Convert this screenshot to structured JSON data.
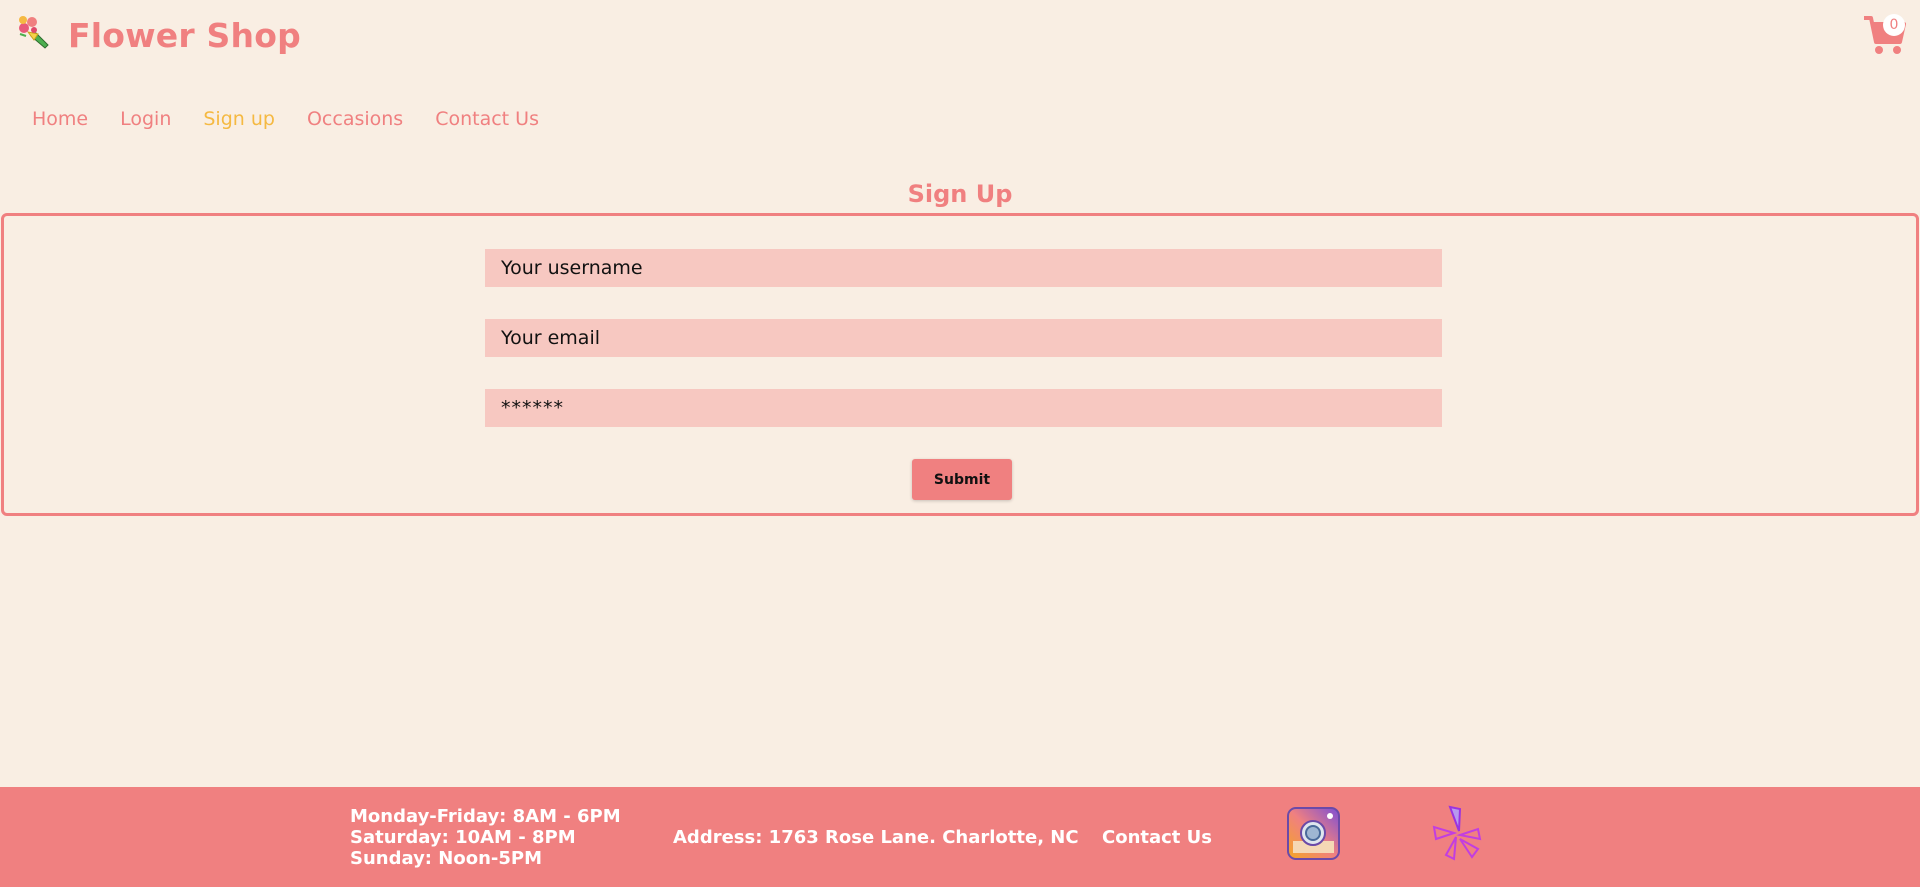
{
  "header": {
    "brand": "Flower Shop",
    "cart_count": "0"
  },
  "nav": {
    "items": [
      {
        "label": "Home"
      },
      {
        "label": "Login"
      },
      {
        "label": "Sign up"
      },
      {
        "label": "Occasions"
      },
      {
        "label": "Contact Us"
      }
    ],
    "active": "Sign up"
  },
  "form": {
    "title": "Sign Up",
    "username_placeholder": "Your username",
    "email_placeholder": "Your email",
    "password_value": "******",
    "submit_label": "Submit"
  },
  "footer": {
    "hours": [
      "Monday-Friday: 8AM - 6PM",
      "Saturday: 10AM - 8PM",
      "Sunday: Noon-5PM"
    ],
    "address": "Address: 1763 Rose Lane. Charlotte, NC",
    "contact_label": "Contact Us"
  },
  "icons": {
    "logo": "bouquet-icon",
    "cart": "shopping-cart-icon",
    "instagram": "instagram-icon",
    "yelp": "yelp-icon"
  },
  "colors": {
    "background": "#f9eee3",
    "accent": "#f08080",
    "active_nav": "#f5b942",
    "input_bg": "#f7c8c1",
    "footer_text": "#ffffff"
  }
}
